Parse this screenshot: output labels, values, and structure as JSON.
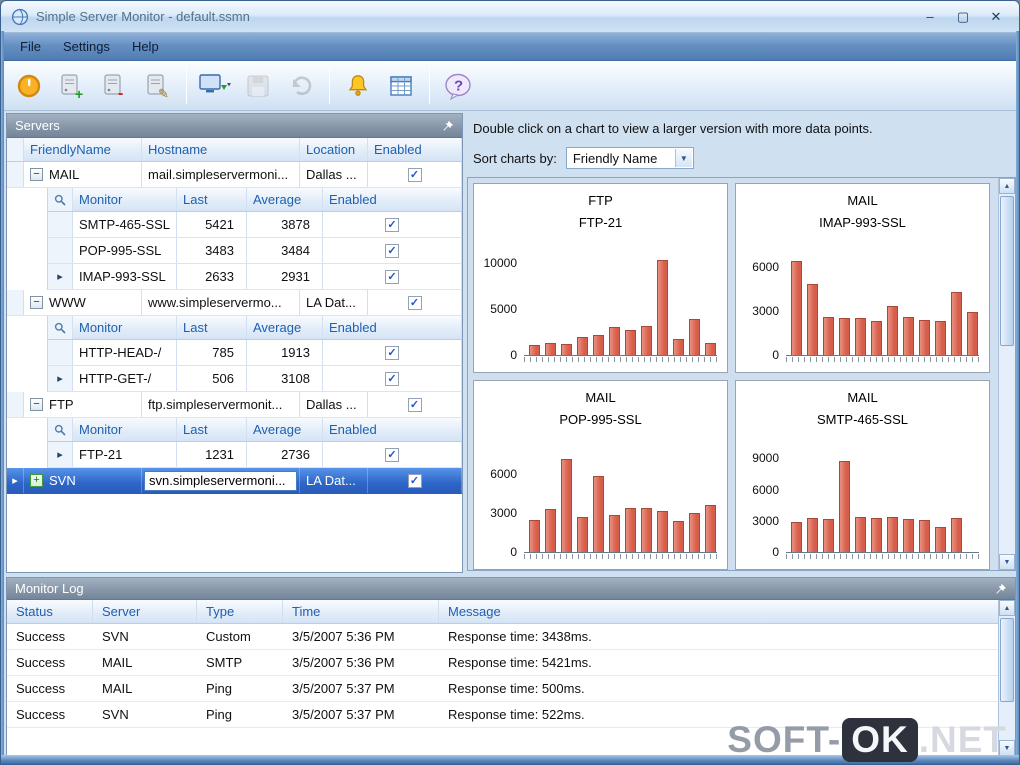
{
  "window": {
    "title": "Simple Server Monitor - default.ssmn",
    "minimize": "–",
    "maximize": "▢",
    "close": "✕"
  },
  "menu": {
    "items": [
      "File",
      "Settings",
      "Help"
    ]
  },
  "toolbar": {
    "buttons": [
      {
        "id": "power",
        "enabled": true
      },
      {
        "id": "add-server",
        "enabled": true
      },
      {
        "id": "remove-server",
        "enabled": true
      },
      {
        "id": "edit-server",
        "enabled": true
      },
      {
        "id": "sep"
      },
      {
        "id": "export-monitor",
        "enabled": true
      },
      {
        "id": "save",
        "enabled": false
      },
      {
        "id": "undo",
        "enabled": false
      },
      {
        "id": "sep"
      },
      {
        "id": "alerts-bell",
        "enabled": true
      },
      {
        "id": "report-grid",
        "enabled": true
      },
      {
        "id": "sep"
      },
      {
        "id": "help",
        "enabled": true
      }
    ]
  },
  "servers_panel": {
    "title": "Servers",
    "columns": [
      "FriendlyName",
      "Hostname",
      "Location",
      "Enabled"
    ],
    "monitor_columns": [
      "Monitor",
      "Last",
      "Average",
      "Enabled"
    ],
    "servers": [
      {
        "name": "MAIL",
        "hostname": "mail.simpleservermoni...",
        "location": "Dallas ...",
        "enabled": true,
        "expanded": true,
        "selected": false,
        "editing": false,
        "monitors": [
          {
            "name": "SMTP-465-SSL",
            "last": "5421",
            "average": "3878",
            "enabled": true,
            "current": false
          },
          {
            "name": "POP-995-SSL",
            "last": "3483",
            "average": "3484",
            "enabled": true,
            "current": false
          },
          {
            "name": "IMAP-993-SSL",
            "last": "2633",
            "average": "2931",
            "enabled": true,
            "current": true
          }
        ]
      },
      {
        "name": "WWW",
        "hostname": "www.simpleservermo...",
        "location": "LA Dat...",
        "enabled": true,
        "expanded": true,
        "selected": false,
        "editing": false,
        "monitors": [
          {
            "name": "HTTP-HEAD-/",
            "last": "785",
            "average": "1913",
            "enabled": true,
            "current": false
          },
          {
            "name": "HTTP-GET-/",
            "last": "506",
            "average": "3108",
            "enabled": true,
            "current": true
          }
        ]
      },
      {
        "name": "FTP",
        "hostname": "ftp.simpleservermonit...",
        "location": "Dallas ...",
        "enabled": true,
        "expanded": true,
        "selected": false,
        "editing": false,
        "monitors": [
          {
            "name": "FTP-21",
            "last": "1231",
            "average": "2736",
            "enabled": true,
            "current": true
          }
        ]
      },
      {
        "name": "SVN",
        "hostname": "svn.simpleservermoni...",
        "location": "LA Dat...",
        "enabled": true,
        "expanded": false,
        "selected": true,
        "editing": true,
        "monitors": []
      }
    ]
  },
  "charts_panel": {
    "hint": "Double click on a chart to view a larger version with more data points.",
    "sort_label": "Sort charts by:",
    "sort_value": "Friendly Name"
  },
  "chart_data": [
    {
      "type": "bar",
      "title": "FTP",
      "subtitle": "FTP-21",
      "yticks": [
        0,
        5000,
        10000
      ],
      "ylim": [
        0,
        11500
      ],
      "xlabel": "",
      "ylabel": "",
      "grid": false,
      "legend": false,
      "values": [
        1100,
        1250,
        1150,
        1950,
        2150,
        3000,
        2700,
        3100,
        10300,
        1700,
        3950,
        1300
      ]
    },
    {
      "type": "bar",
      "title": "MAIL",
      "subtitle": "IMAP-993-SSL",
      "yticks": [
        0,
        3000,
        6000
      ],
      "ylim": [
        0,
        7200
      ],
      "xlabel": "",
      "ylabel": "",
      "grid": false,
      "legend": false,
      "values": [
        6400,
        4800,
        2600,
        2500,
        2500,
        2300,
        3300,
        2600,
        2400,
        2300,
        4300,
        2900
      ]
    },
    {
      "type": "bar",
      "title": "MAIL",
      "subtitle": "POP-995-SSL",
      "yticks": [
        0,
        3000,
        6000
      ],
      "ylim": [
        0,
        8200
      ],
      "xlabel": "",
      "ylabel": "",
      "grid": false,
      "legend": false,
      "values": [
        2500,
        3300,
        7200,
        2700,
        5900,
        2900,
        3400,
        3400,
        3200,
        2400,
        3000,
        3600
      ]
    },
    {
      "type": "bar",
      "title": "MAIL",
      "subtitle": "SMTP-465-SSL",
      "yticks": [
        0,
        3000,
        6000,
        9000
      ],
      "ylim": [
        0,
        10200
      ],
      "xlabel": "",
      "ylabel": "",
      "grid": false,
      "legend": false,
      "values": [
        2900,
        3300,
        3200,
        8800,
        3400,
        3300,
        3400,
        3200,
        3100,
        2400,
        3300
      ]
    }
  ],
  "log_panel": {
    "title": "Monitor Log",
    "columns": [
      "Status",
      "Server",
      "Type",
      "Time",
      "Message"
    ],
    "rows": [
      [
        "Success",
        "SVN",
        "Custom",
        "3/5/2007 5:36 PM",
        "Response time: 3438ms."
      ],
      [
        "Success",
        "MAIL",
        "SMTP",
        "3/5/2007 5:36 PM",
        "Response time: 5421ms."
      ],
      [
        "Success",
        "MAIL",
        "Ping",
        "3/5/2007 5:37 PM",
        "Response time: 500ms."
      ],
      [
        "Success",
        "SVN",
        "Ping",
        "3/5/2007 5:37 PM",
        "Response time: 522ms."
      ]
    ]
  },
  "watermark": {
    "prefix": "SOFT-",
    "badge": "OK",
    "suffix": ".NET"
  }
}
